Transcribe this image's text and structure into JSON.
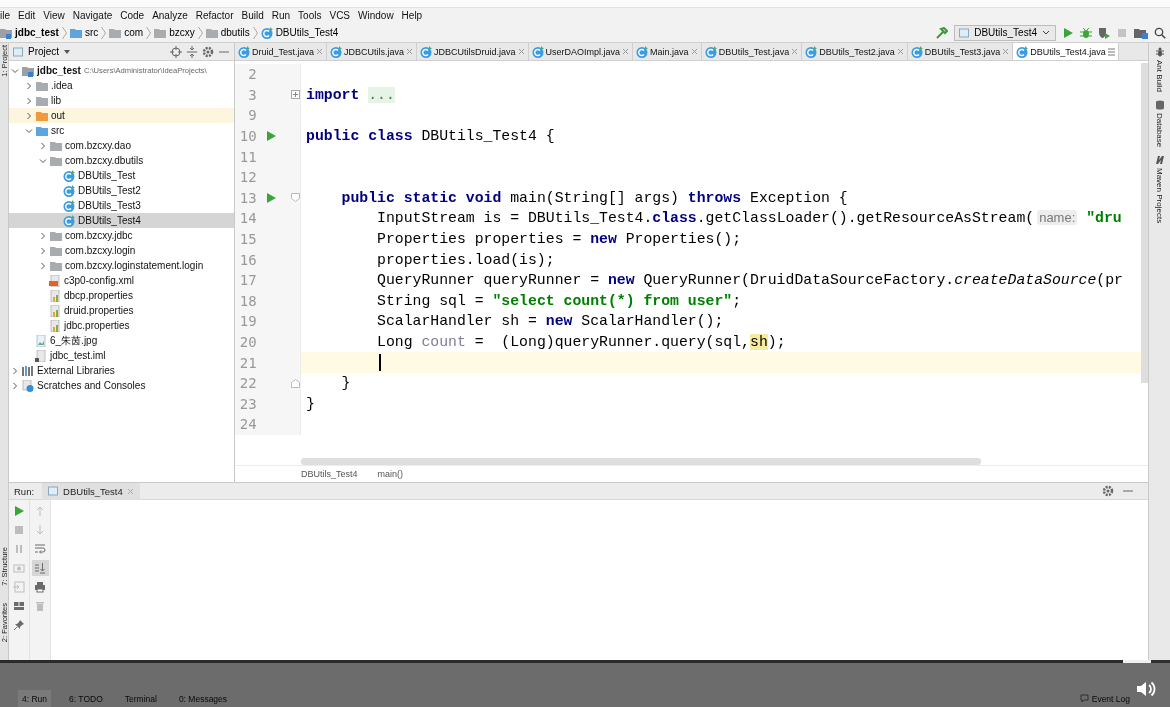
{
  "menu": [
    "ile",
    "Edit",
    "View",
    "Navigate",
    "Code",
    "Analyze",
    "Refactor",
    "Build",
    "Run",
    "Tools",
    "VCS",
    "Window",
    "Help"
  ],
  "navigation": {
    "breadcrumbs": [
      {
        "label": "jdbc_test",
        "kind": "project"
      },
      {
        "label": "src",
        "kind": "source-folder"
      },
      {
        "label": "com",
        "kind": "package"
      },
      {
        "label": "bzcxy",
        "kind": "package"
      },
      {
        "label": "dbutils",
        "kind": "package"
      },
      {
        "label": "DBUtils_Test4",
        "kind": "class"
      }
    ],
    "run_config": "DBUtils_Test4"
  },
  "left_stripe": [
    "1: Project",
    "7: Structure",
    "2: Favorites"
  ],
  "project_panel": {
    "title": "Project",
    "tree": [
      {
        "label": "jdbc_test",
        "path": "C:\\Users\\Administrator\\IdeaProjects\\",
        "kind": "project",
        "expanded": true,
        "selected": false,
        "children": [
          {
            "label": ".idea",
            "kind": "folder",
            "expanded": false,
            "selected": false
          },
          {
            "label": "lib",
            "kind": "folder",
            "expanded": false,
            "selected": false
          },
          {
            "label": "out",
            "kind": "excluded-folder",
            "expanded": false,
            "selected": false
          },
          {
            "label": "src",
            "kind": "source-folder",
            "expanded": true,
            "selected": false,
            "children": [
              {
                "label": "com.bzcxy.dao",
                "kind": "package",
                "expanded": false,
                "selected": false
              },
              {
                "label": "com.bzcxy.dbutils",
                "kind": "package",
                "expanded": true,
                "selected": false,
                "children": [
                  {
                    "label": "DBUtils_Test",
                    "kind": "class",
                    "selected": false
                  },
                  {
                    "label": "DBUtils_Test2",
                    "kind": "class",
                    "selected": false
                  },
                  {
                    "label": "DBUtils_Test3",
                    "kind": "class",
                    "selected": false
                  },
                  {
                    "label": "DBUtils_Test4",
                    "kind": "class",
                    "selected": true
                  }
                ]
              },
              {
                "label": "com.bzcxy.jdbc",
                "kind": "package",
                "expanded": false,
                "selected": false
              },
              {
                "label": "com.bzcxy.login",
                "kind": "package",
                "expanded": false,
                "selected": false
              },
              {
                "label": "com.bzcxy.loginstatement.login",
                "kind": "package",
                "expanded": false,
                "selected": false
              },
              {
                "label": "c3p0-config.xml",
                "kind": "xml",
                "selected": false
              },
              {
                "label": "dbcp.properties",
                "kind": "properties",
                "selected": false
              },
              {
                "label": "druid.properties",
                "kind": "properties",
                "selected": false
              },
              {
                "label": "jdbc.properties",
                "kind": "properties",
                "selected": false
              }
            ]
          },
          {
            "label": "6_朱茵.jpg",
            "kind": "image",
            "selected": false
          },
          {
            "label": "jdbc_test.iml",
            "kind": "module",
            "selected": false
          }
        ]
      },
      {
        "label": "External Libraries",
        "kind": "libraries",
        "expanded": false,
        "selected": false
      },
      {
        "label": "Scratches and Consoles",
        "kind": "scratches",
        "expanded": false,
        "selected": false
      }
    ]
  },
  "editor": {
    "tabs": [
      {
        "label": "Druid_Test.java",
        "selected": false
      },
      {
        "label": "JDBCUtils.java",
        "selected": false
      },
      {
        "label": "JDBCUtilsDruid.java",
        "selected": false
      },
      {
        "label": "UserDAOImpl.java",
        "selected": false
      },
      {
        "label": "Main.java",
        "selected": false
      },
      {
        "label": "DBUtils_Test.java",
        "selected": false
      },
      {
        "label": "DBUtils_Test2.java",
        "selected": false
      },
      {
        "label": "DBUtils_Test3.java",
        "selected": false
      },
      {
        "label": "DBUtils_Test4.java",
        "selected": true
      }
    ],
    "lines": [
      {
        "number": "2",
        "current": false
      },
      {
        "number": "3",
        "current": false,
        "fold": {
          "kind": "collapsed"
        },
        "tokens": [
          {
            "kind": "keyword",
            "text": "import "
          },
          {
            "kind": "folded",
            "text": "..."
          }
        ]
      },
      {
        "number": "9",
        "current": false
      },
      {
        "number": "10",
        "current": false,
        "run_marker": true,
        "tokens": [
          {
            "kind": "keyword",
            "text": "public class"
          },
          {
            "kind": "plain",
            "text": " DBUtils_Test4 {"
          }
        ]
      },
      {
        "number": "11",
        "current": false
      },
      {
        "number": "12",
        "current": false
      },
      {
        "number": "13",
        "current": false,
        "run_marker": true,
        "fold": {
          "kind": "start"
        },
        "tokens": [
          {
            "kind": "keyword",
            "text": "    public static void"
          },
          {
            "kind": "plain",
            "text": " main(String[] args) "
          },
          {
            "kind": "keyword",
            "text": "throws"
          },
          {
            "kind": "plain",
            "text": " Exception {"
          }
        ]
      },
      {
        "number": "14",
        "current": false,
        "tokens": [
          {
            "kind": "plain",
            "text": "        InputStream is = DBUtils_Test4."
          },
          {
            "kind": "keyword",
            "text": "class"
          },
          {
            "kind": "plain",
            "text": ".getClassLoader().getResourceAsStream("
          },
          {
            "kind": "hint",
            "text": "name:"
          },
          {
            "kind": "string",
            "text": " \"dru"
          }
        ]
      },
      {
        "number": "15",
        "current": false,
        "tokens": [
          {
            "kind": "plain",
            "text": "        Properties properties = "
          },
          {
            "kind": "keyword",
            "text": "new"
          },
          {
            "kind": "plain",
            "text": " Properties();"
          }
        ]
      },
      {
        "number": "16",
        "current": false,
        "tokens": [
          {
            "kind": "plain",
            "text": "        properties.load(is);"
          }
        ]
      },
      {
        "number": "17",
        "current": false,
        "tokens": [
          {
            "kind": "plain",
            "text": "        QueryRunner queryRunner = "
          },
          {
            "kind": "keyword",
            "text": "new"
          },
          {
            "kind": "plain",
            "text": " QueryRunner(DruidDataSourceFactory."
          },
          {
            "kind": "italic",
            "text": "createDataSource"
          },
          {
            "kind": "plain",
            "text": "(pr"
          }
        ]
      },
      {
        "number": "18",
        "current": false,
        "tokens": [
          {
            "kind": "plain",
            "text": "        String sql = "
          },
          {
            "kind": "string",
            "text": "\"select count(*) from user\""
          },
          {
            "kind": "plain",
            "text": ";"
          }
        ]
      },
      {
        "number": "19",
        "current": false,
        "tokens": [
          {
            "kind": "plain",
            "text": "        ScalarHandler sh = "
          },
          {
            "kind": "keyword",
            "text": "new"
          },
          {
            "kind": "plain",
            "text": " ScalarHandler();"
          }
        ]
      },
      {
        "number": "20",
        "current": false,
        "tokens": [
          {
            "kind": "plain",
            "text": "        Long "
          },
          {
            "kind": "unused",
            "text": "count"
          },
          {
            "kind": "plain",
            "text": " =  (Long)queryRunner.query(sql,"
          },
          {
            "kind": "match",
            "text": "sh"
          },
          {
            "kind": "plain",
            "text": ");"
          }
        ]
      },
      {
        "number": "21",
        "current": true
      },
      {
        "number": "22",
        "current": false,
        "fold": {
          "kind": "end"
        },
        "tokens": [
          {
            "kind": "plain",
            "text": "    }"
          }
        ]
      },
      {
        "number": "23",
        "current": false,
        "tokens": [
          {
            "kind": "plain",
            "text": "}"
          }
        ]
      },
      {
        "number": "24",
        "current": false
      }
    ],
    "breadcrumb": [
      "DBUtils_Test4",
      "main()"
    ]
  },
  "right_stripe": [
    {
      "label": "Ant Build",
      "kind": "ant"
    },
    {
      "label": "Database",
      "kind": "database"
    },
    {
      "label": "Maven Projects",
      "kind": "maven"
    }
  ],
  "run_panel": {
    "label": "Run:",
    "tab": "DBUtils_Test4",
    "left_tools": [
      {
        "kind": "rerun",
        "disabled": false
      },
      {
        "kind": "stop",
        "disabled": true
      },
      {
        "kind": "pause",
        "disabled": true
      },
      {
        "kind": "camera",
        "disabled": true
      },
      {
        "kind": "exit",
        "disabled": true
      },
      {
        "kind": "layout",
        "disabled": false
      },
      {
        "kind": "pin",
        "disabled": false
      }
    ],
    "output_tools": [
      {
        "kind": "up",
        "disabled": true,
        "on": false
      },
      {
        "kind": "down",
        "disabled": true,
        "on": false
      },
      {
        "kind": "wrap",
        "disabled": false,
        "on": false
      },
      {
        "kind": "scroll-end",
        "disabled": false,
        "on": true
      },
      {
        "kind": "print",
        "disabled": false,
        "on": false
      },
      {
        "kind": "trash",
        "disabled": true,
        "on": false
      }
    ]
  },
  "bottom_bar": {
    "tabs": [
      {
        "label": "4: Run",
        "selected": true
      },
      {
        "label": "6: TODO",
        "selected": false
      },
      {
        "label": "Terminal",
        "selected": false
      },
      {
        "label": "0: Messages",
        "selected": false
      }
    ],
    "event_log": "Event Log",
    "progress": {
      "level": 0.96
    }
  }
}
